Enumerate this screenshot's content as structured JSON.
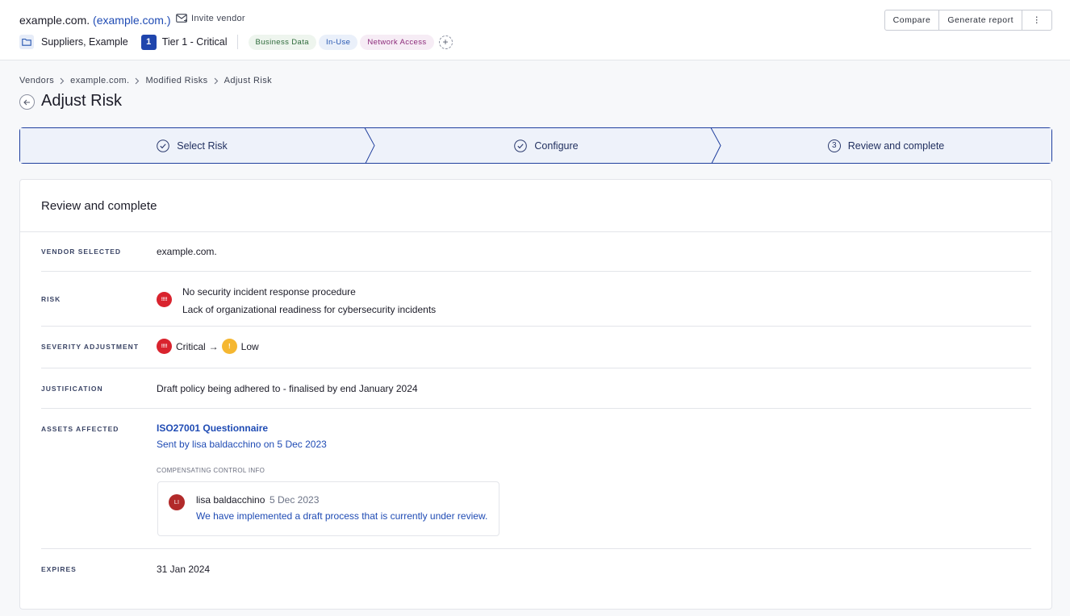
{
  "header": {
    "vendor_name": "example.com.",
    "vendor_domain_open": "(",
    "vendor_domain": "example.com.",
    "vendor_domain_close": ")",
    "invite_label": "Invite vendor",
    "portfolio": "Suppliers, Example",
    "tier_number": "1",
    "tier_label": "Tier 1 - Critical",
    "labels": [
      "Business Data",
      "In-Use",
      "Network Access"
    ],
    "add_label": "+",
    "buttons": {
      "compare": "Compare",
      "generate_report": "Generate report",
      "more": "⋮"
    }
  },
  "breadcrumb": [
    "Vendors",
    "example.com.",
    "Modified Risks",
    "Adjust Risk"
  ],
  "page": {
    "title": "Adjust Risk"
  },
  "stepper": {
    "steps": [
      {
        "label": "Select Risk",
        "state": "complete"
      },
      {
        "label": "Configure",
        "state": "complete"
      },
      {
        "label": "Review and complete",
        "state": "current",
        "number": "3"
      }
    ]
  },
  "review": {
    "title": "Review and complete",
    "vendor_selected": {
      "label": "Vendor selected",
      "value": "example.com."
    },
    "risk": {
      "label": "Risk",
      "badge": "!!!!",
      "title": "No security incident response procedure",
      "description": "Lack of organizational readiness for cybersecurity incidents"
    },
    "severity_adjustment": {
      "label": "Severity adjustment",
      "from_badge": "!!!!",
      "from": "Critical",
      "arrow": "→",
      "to_badge": "!",
      "to": "Low"
    },
    "justification": {
      "label": "Justification",
      "value": "Draft policy being adhered to - finalised by end January 2024"
    },
    "assets_affected": {
      "label": "Assets affected",
      "asset_name": "ISO27001 Questionnaire",
      "asset_sub": "Sent by lisa baldacchino on 5 Dec 2023",
      "compensating_label": "Compensating control info",
      "comment": {
        "initials": "LI",
        "author": "lisa baldacchino",
        "date": "5 Dec 2023",
        "text": "We have implemented a draft process that is currently under review."
      }
    },
    "expires": {
      "label": "Expires",
      "value": "31 Jan 2024"
    }
  },
  "colors": {
    "accent": "#1f4bb4",
    "tier_badge": "#1f45ad",
    "critical": "#d9232e",
    "low": "#f5b731",
    "avatar": "#b22a2a"
  }
}
